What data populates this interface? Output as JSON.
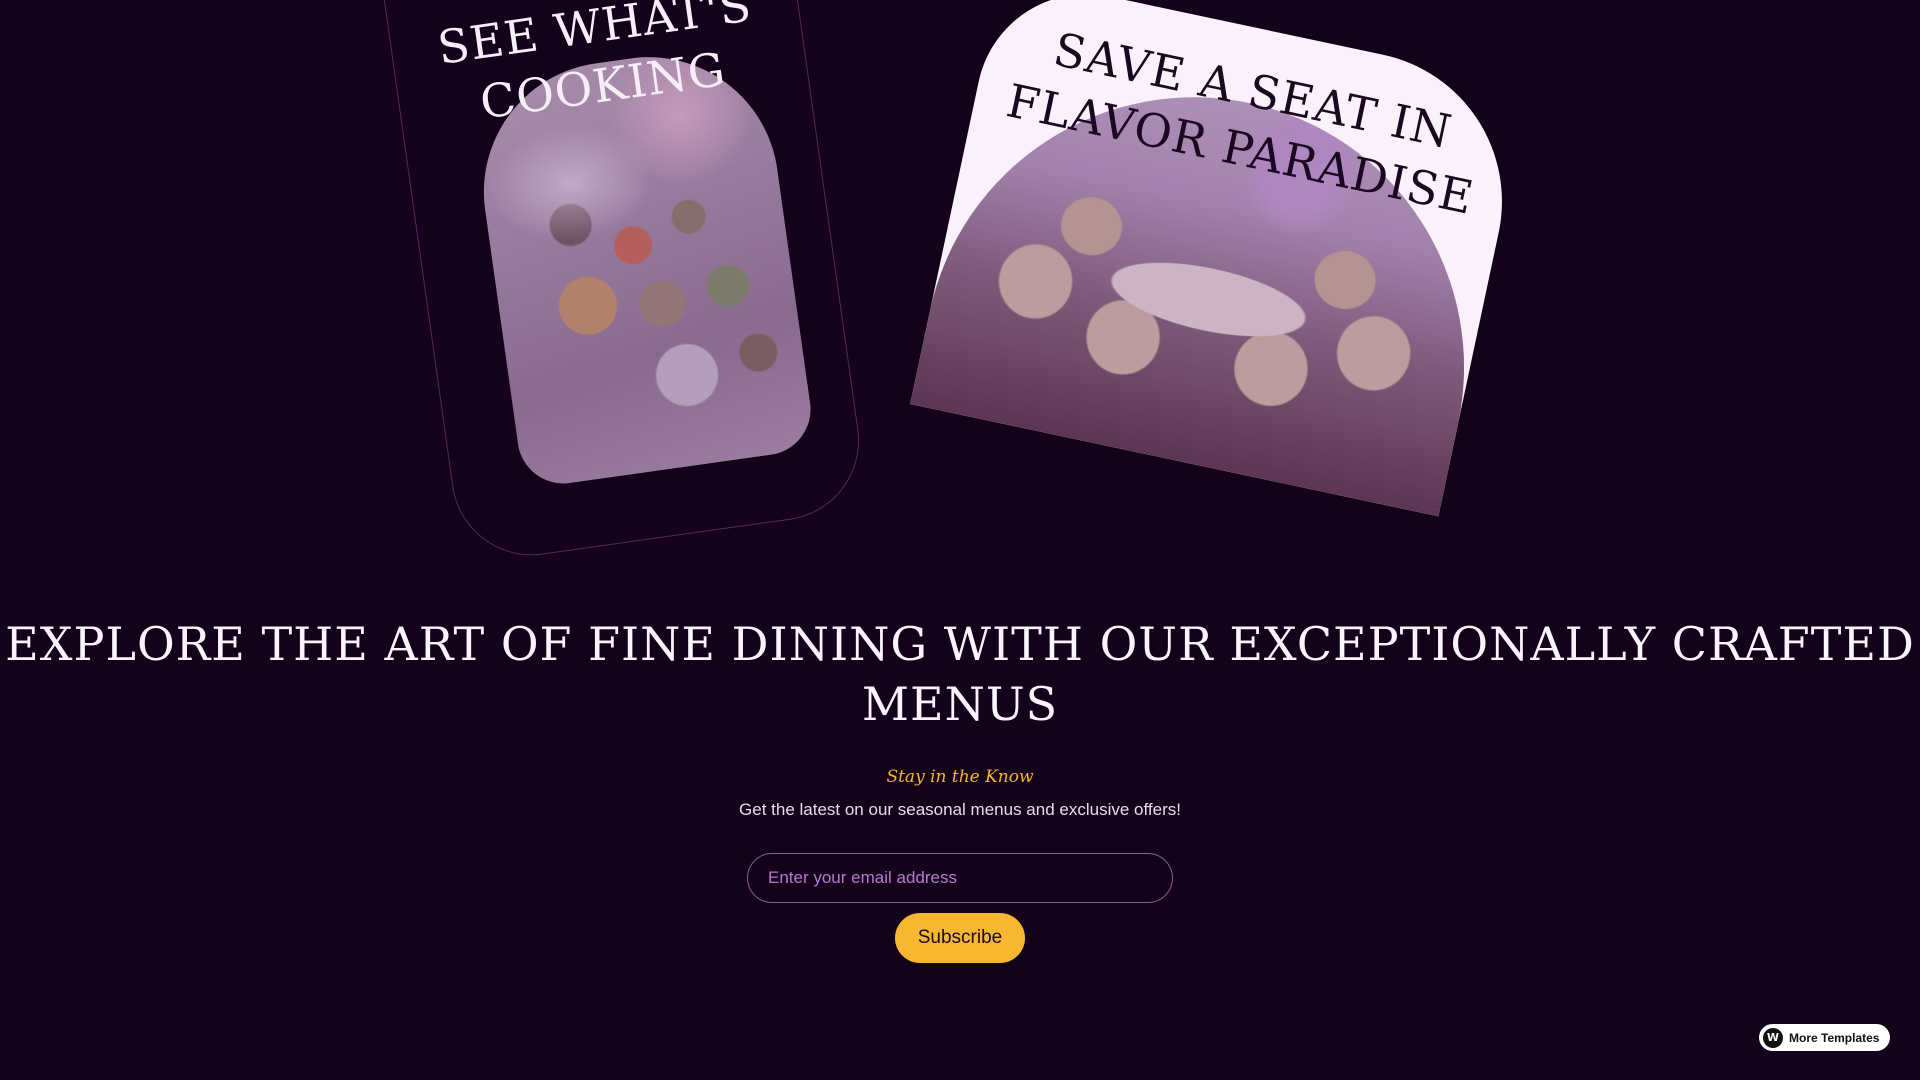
{
  "cards": {
    "cooking": {
      "title": "See What's Cooking"
    },
    "seat": {
      "title": "Save a Seat in Flavor Paradise"
    }
  },
  "headline": "EXPLORE THE ART OF FINE DINING WITH OUR EXCEPTIONALLY CRAFTED MENUS",
  "newsletter": {
    "kicker": "Stay in the Know",
    "subtext": "Get the latest on our seasonal menus and exclusive offers!",
    "email_placeholder": "Enter your email address",
    "subscribe_label": "Subscribe"
  },
  "badge": {
    "label": "More Templates",
    "icon": "webflow-logo-icon"
  },
  "colors": {
    "background": "#14021a",
    "accent": "#f7b731",
    "card_light": "#fbf1fc",
    "input_border": "#8e5aa1"
  }
}
